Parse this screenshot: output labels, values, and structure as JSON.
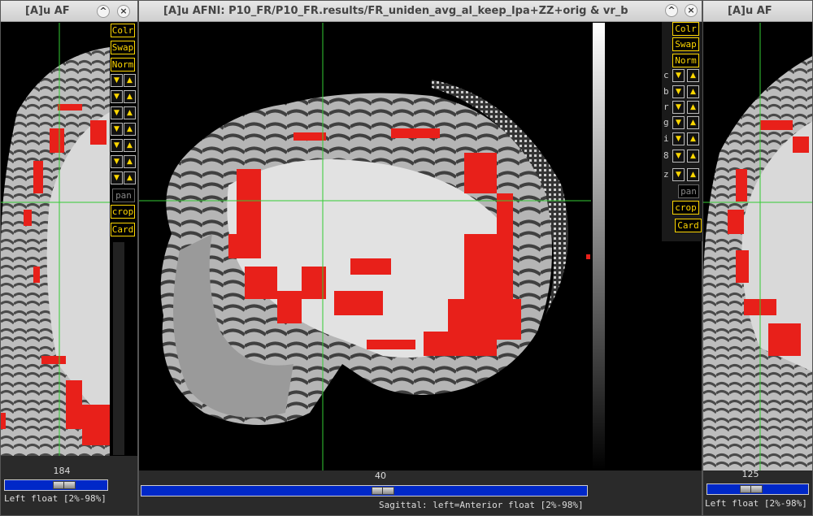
{
  "windows": {
    "left": {
      "title": "[A]u AF",
      "slice_number": "184",
      "status": "Left float [2%-98%]",
      "slider_fraction": 0.55
    },
    "center": {
      "title": "[A]u AFNI: P10_FR/P10_FR.results/FR_uniden_avg_al_keep_lpa+ZZ+orig & vr_b",
      "slice_number": "40",
      "status": "Sagittal: left=Anterior float [2%-98%]",
      "slider_fraction": 0.53
    },
    "right": {
      "title": "[A]u AF",
      "slice_number": "125",
      "status": "Left float [2%-98%]",
      "slider_fraction": 0.42
    }
  },
  "title_buttons": {
    "minimize": "–",
    "maximize": "^",
    "close": "×"
  },
  "controls": {
    "colr": "Colr",
    "swap": "Swap",
    "norm": "Norm",
    "pan": "pan",
    "crop": "crop",
    "card": "Card",
    "arrow_rows": [
      "c",
      "b",
      "r",
      "g",
      "i",
      "8",
      "z"
    ],
    "down_arrow": "▼",
    "up_arrow": "▲"
  },
  "colors": {
    "crosshair": "#33cc33",
    "overlay": "#e8201a",
    "button_text": "#ffd700",
    "slider": "#0028c8"
  }
}
